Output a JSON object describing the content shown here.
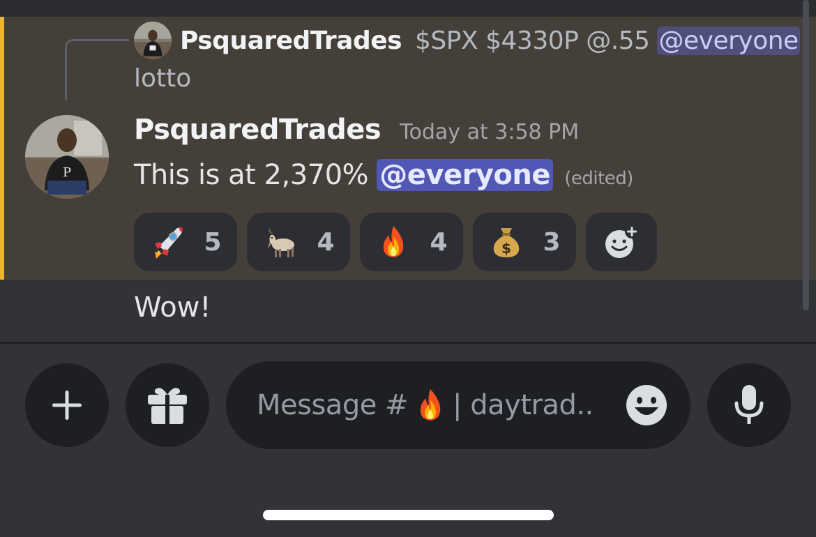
{
  "reply": {
    "author": "PsquaredTrades",
    "text": "$SPX $4330P @.55",
    "mention": "@everyone",
    "text_line2": "lotto"
  },
  "message": {
    "author": "PsquaredTrades",
    "timestamp": "Today at 3:58 PM",
    "text": "This is at 2,370%",
    "mention": "@everyone",
    "edited_label": "(edited)",
    "reactions": [
      {
        "icon": "rocket-emoji",
        "count": "5"
      },
      {
        "icon": "goat-emoji",
        "count": "4"
      },
      {
        "icon": "fire-emoji",
        "count": "4"
      },
      {
        "icon": "money-bag-emoji",
        "count": "3"
      }
    ],
    "add_reaction_icon": "add-reaction-icon"
  },
  "next_message": {
    "text": "Wow!"
  },
  "composer": {
    "placeholder_prefix": "Message #",
    "placeholder_suffix": "| daytrad..",
    "plus_icon": "plus-icon",
    "gift_icon": "gift-icon",
    "emoji_icon": "emoji-icon",
    "mic_icon": "microphone-icon"
  },
  "colors": {
    "highlight_background": "#444039",
    "highlight_bar": "#f0b232",
    "mention": "#5057b5",
    "app_background": "#313338"
  }
}
